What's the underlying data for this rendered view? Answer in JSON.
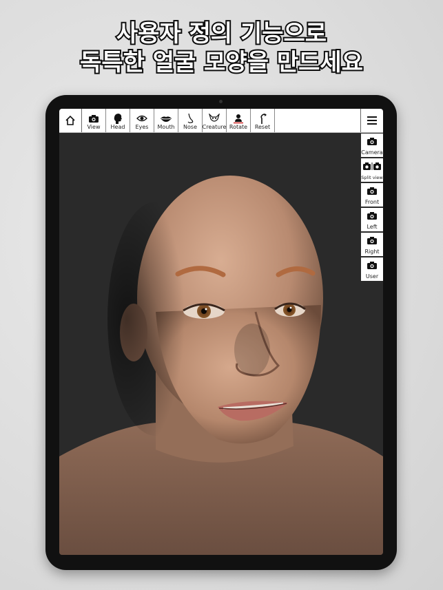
{
  "headline": {
    "line1": "사용자 정의 기능으로",
    "line2": "독특한 얼굴 모양을 만드세요"
  },
  "toolbar": {
    "items": [
      {
        "label": "View",
        "icon": "camera-icon"
      },
      {
        "label": "Head",
        "icon": "head-icon"
      },
      {
        "label": "Eyes",
        "icon": "eye-icon"
      },
      {
        "label": "Mouth",
        "icon": "lips-icon"
      },
      {
        "label": "Nose",
        "icon": "nose-icon"
      },
      {
        "label": "Creature",
        "icon": "creature-icon"
      },
      {
        "label": "Rotate",
        "icon": "rotate-figure-icon"
      },
      {
        "label": "Reset",
        "icon": "reset-icon"
      }
    ]
  },
  "sidebar": {
    "items": [
      {
        "label": "Camera"
      },
      {
        "label": "Split view"
      },
      {
        "label": "Front"
      },
      {
        "label": "Left"
      },
      {
        "label": "Right"
      },
      {
        "label": "User"
      }
    ]
  },
  "colors": {
    "viewport_bg": "#2a2a2a",
    "skin": "#b98a70",
    "toolbar_bg": "#ffffff"
  }
}
